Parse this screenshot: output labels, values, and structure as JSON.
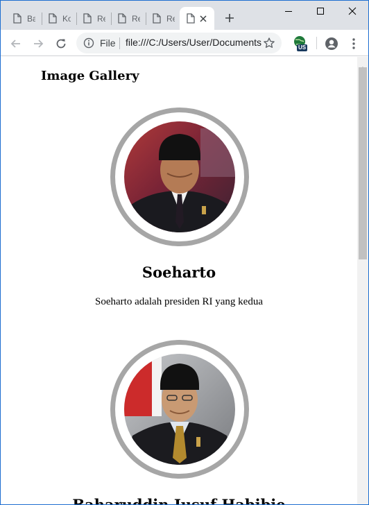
{
  "browser": {
    "tabs": [
      {
        "label": "Ba",
        "active": false
      },
      {
        "label": "Ko",
        "active": false
      },
      {
        "label": "Re",
        "active": false
      },
      {
        "label": "Re",
        "active": false
      },
      {
        "label": "Re",
        "active": false
      },
      {
        "label": "",
        "active": true
      }
    ],
    "omnibox": {
      "scheme_label": "File",
      "url": "file:///C:/Users/User/Documents/gallery.html"
    },
    "extension_badge": "US"
  },
  "page": {
    "title": "Image Gallery",
    "people": [
      {
        "name": "Soeharto",
        "description": "Soeharto adalah presiden RI yang kedua"
      },
      {
        "name": "Baharuddin Jusuf Habibie",
        "description": ""
      }
    ]
  },
  "colors": {
    "tabstrip": "#dee1e6",
    "window_border": "#1c6dd0",
    "ring": "#a6a6a6"
  }
}
